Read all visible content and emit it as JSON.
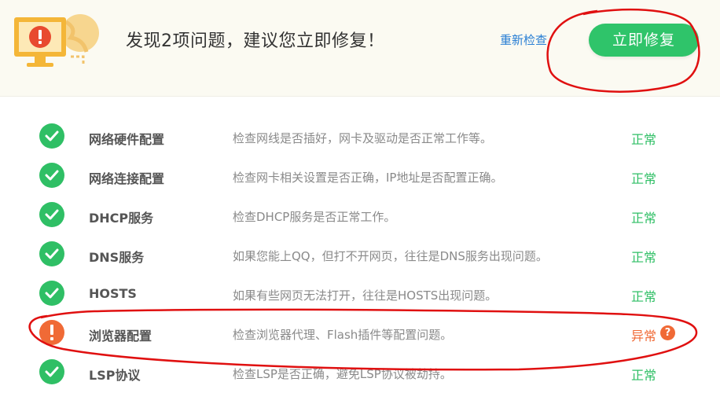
{
  "header": {
    "title": "发现2项问题，建议您立即修复！",
    "recheck_label": "重新检查",
    "fix_button_label": "立即修复"
  },
  "rows": [
    {
      "name": "网络硬件配置",
      "description": "检查网线是否插好，网卡及驱动是否正常工作等。",
      "status": "正常",
      "state": "ok"
    },
    {
      "name": "网络连接配置",
      "description": "检查网卡相关设置是否正确，IP地址是否配置正确。",
      "status": "正常",
      "state": "ok"
    },
    {
      "name": "DHCP服务",
      "description": "检查DHCP服务是否正常工作。",
      "status": "正常",
      "state": "ok"
    },
    {
      "name": "DNS服务",
      "description": "如果您能上QQ，但打不开网页，往往是DNS服务出现问题。",
      "status": "正常",
      "state": "ok"
    },
    {
      "name": "HOSTS",
      "description": "如果有些网页无法打开，往往是HOSTS出现问题。",
      "status": "正常",
      "state": "ok"
    },
    {
      "name": "浏览器配置",
      "description": "检查浏览器代理、Flash插件等配置问题。",
      "status": "异常",
      "state": "err",
      "help": "?"
    },
    {
      "name": "LSP协议",
      "description": "检查LSP是否正确，避免LSP协议被劫持。",
      "status": "正常",
      "state": "ok"
    }
  ],
  "colors": {
    "ok": "#2fbf65",
    "error": "#f06a36",
    "link": "#2a7fd4",
    "annotation": "#e01010"
  }
}
